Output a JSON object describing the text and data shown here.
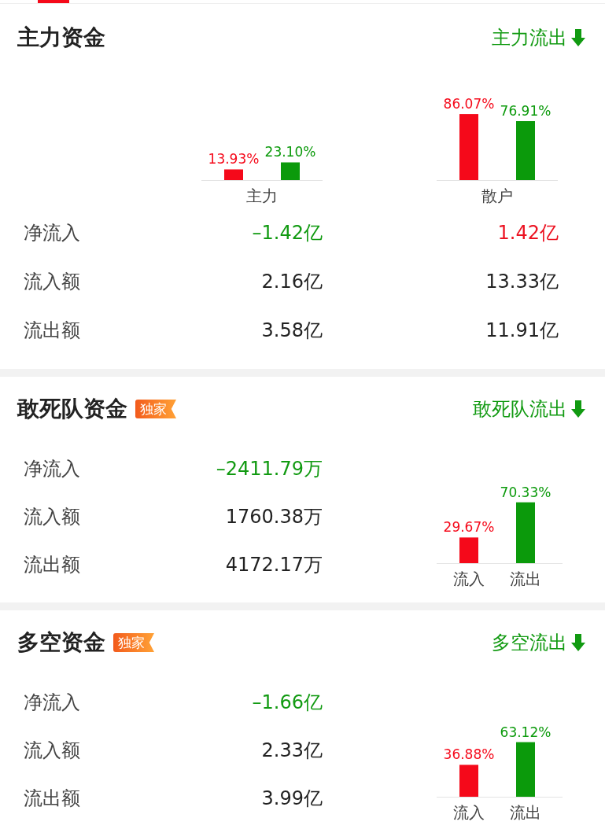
{
  "main_fund": {
    "title": "主力资金",
    "direction": {
      "text": "主力流出",
      "color": "#119a11"
    },
    "chart_data": {
      "type": "bar",
      "categories": [
        "主力",
        "散户"
      ],
      "data_labels": true,
      "series": [
        {
          "color": "#f5091a",
          "values": [
            13.93,
            86.07
          ],
          "value_labels": [
            "13.93%",
            "86.07%"
          ]
        },
        {
          "color": "#0b9a0b",
          "values": [
            23.1,
            76.91
          ],
          "value_labels": [
            "23.10%",
            "76.91%"
          ]
        }
      ]
    },
    "rows": [
      {
        "label": "净流入",
        "values": [
          {
            "text": "–1.42亿",
            "color": "#119a11"
          },
          {
            "text": "1.42亿",
            "color": "#ec1221"
          }
        ]
      },
      {
        "label": "流入额",
        "values": [
          {
            "text": "2.16亿",
            "color": "#222222"
          },
          {
            "text": "13.33亿",
            "color": "#222222"
          }
        ]
      },
      {
        "label": "流出额",
        "values": [
          {
            "text": "3.58亿",
            "color": "#222222"
          },
          {
            "text": "11.91亿",
            "color": "#222222"
          }
        ]
      }
    ]
  },
  "sections": [
    {
      "title": "敢死队资金",
      "badge": "独家",
      "direction": {
        "text": "敢死队流出",
        "color": "#119a11"
      },
      "rows": [
        {
          "label": "净流入",
          "value": {
            "text": "–2411.79万",
            "color": "#119a11"
          }
        },
        {
          "label": "流入额",
          "value": {
            "text": "1760.38万",
            "color": "#222222"
          }
        },
        {
          "label": "流出额",
          "value": {
            "text": "4172.17万",
            "color": "#222222"
          }
        }
      ],
      "chart_data": {
        "type": "bar",
        "categories": [
          "流入",
          "流出"
        ],
        "data_labels": true,
        "series": [
          {
            "color": "#f5091a",
            "values": [
              29.67,
              null
            ],
            "value_labels": [
              "29.67%",
              null
            ]
          },
          {
            "color": "#0b9a0b",
            "values": [
              null,
              70.33
            ],
            "value_labels": [
              null,
              "70.33%"
            ]
          }
        ]
      }
    },
    {
      "title": "多空资金",
      "badge": "独家",
      "direction": {
        "text": "多空流出",
        "color": "#119a11"
      },
      "rows": [
        {
          "label": "净流入",
          "value": {
            "text": "–1.66亿",
            "color": "#119a11"
          }
        },
        {
          "label": "流入额",
          "value": {
            "text": "2.33亿",
            "color": "#222222"
          }
        },
        {
          "label": "流出额",
          "value": {
            "text": "3.99亿",
            "color": "#222222"
          }
        }
      ],
      "chart_data": {
        "type": "bar",
        "categories": [
          "流入",
          "流出"
        ],
        "data_labels": true,
        "series": [
          {
            "color": "#f5091a",
            "values": [
              36.88,
              null
            ],
            "value_labels": [
              "36.88%",
              null
            ]
          },
          {
            "color": "#0b9a0b",
            "values": [
              null,
              63.12
            ],
            "value_labels": [
              null,
              "63.12%"
            ]
          }
        ]
      }
    }
  ]
}
